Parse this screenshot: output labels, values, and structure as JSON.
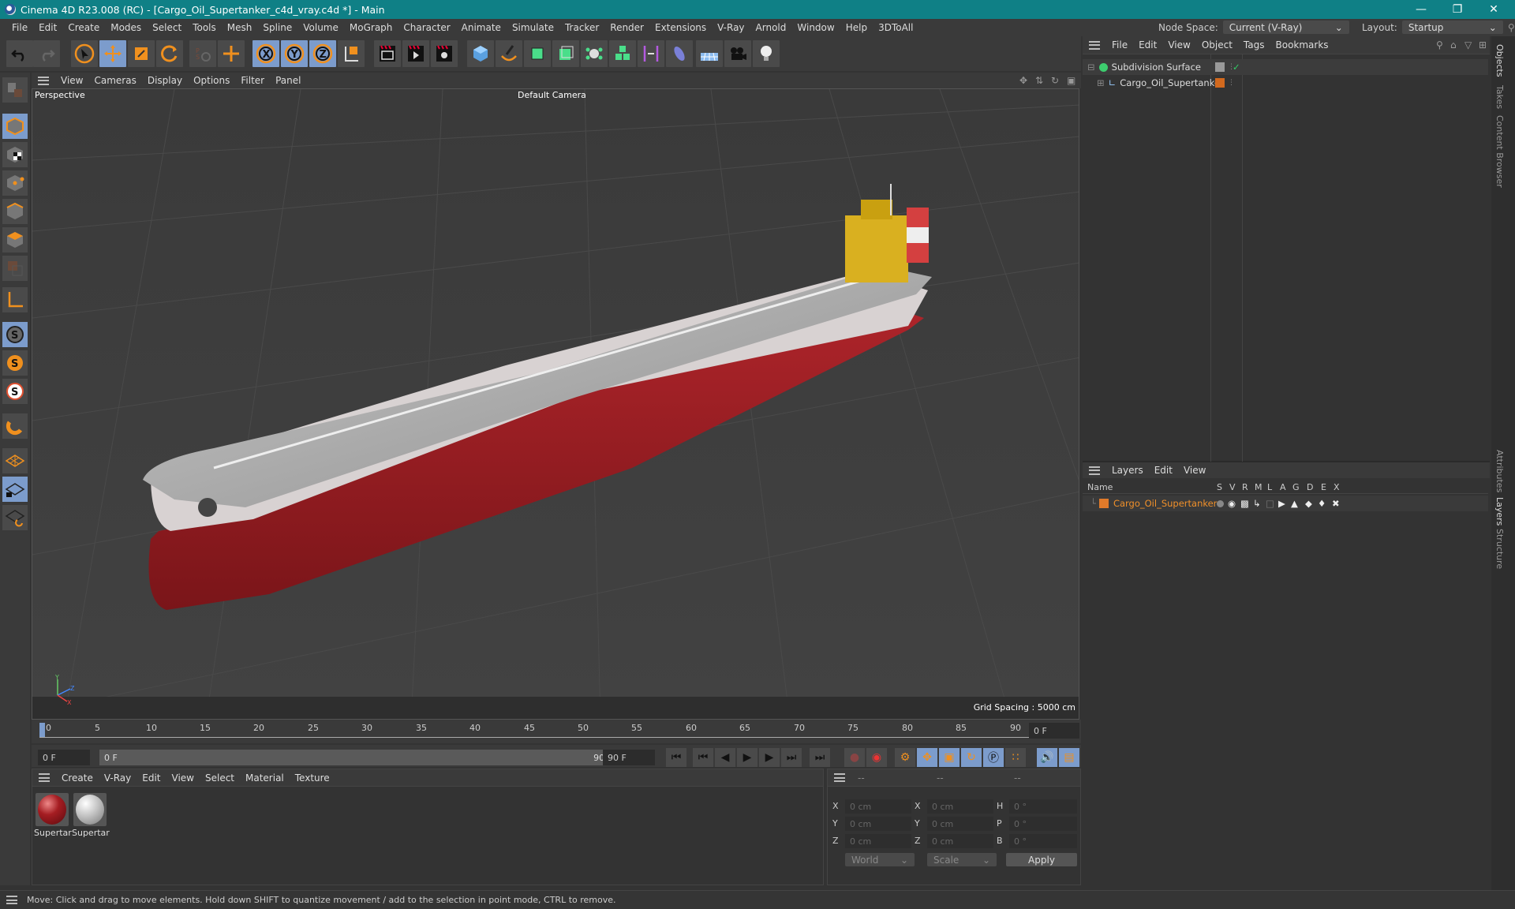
{
  "window": {
    "title": "Cinema 4D R23.008 (RC) - [Cargo_Oil_Supertanker_c4d_vray.c4d *] - Main",
    "controls": [
      "minimize",
      "restore",
      "close"
    ]
  },
  "menubar": {
    "items": [
      "File",
      "Edit",
      "Create",
      "Modes",
      "Select",
      "Tools",
      "Mesh",
      "Spline",
      "Volume",
      "MoGraph",
      "Character",
      "Animate",
      "Simulate",
      "Tracker",
      "Render",
      "Extensions",
      "V-Ray",
      "Arnold",
      "Window",
      "Help",
      "3DToAll"
    ],
    "node_space_label": "Node Space:",
    "node_space_value": "Current (V-Ray)",
    "layout_label": "Layout:",
    "layout_value": "Startup"
  },
  "toolbar": {
    "buttons": [
      {
        "icon": "undo-icon"
      },
      {
        "icon": "redo-icon"
      },
      {
        "icon": "select-arrow-icon"
      },
      {
        "icon": "move-icon",
        "active": true
      },
      {
        "icon": "scale-icon"
      },
      {
        "icon": "rotate-icon"
      },
      {
        "icon": "psr-icon"
      },
      {
        "icon": "move-alt-icon"
      },
      {
        "icon": "x-axis-icon",
        "label": "X",
        "active": true
      },
      {
        "icon": "y-axis-icon",
        "label": "Y",
        "active": true
      },
      {
        "icon": "z-axis-icon",
        "label": "Z",
        "active": true
      },
      {
        "icon": "coordinate-system-icon"
      },
      {
        "icon": "render-view-icon"
      },
      {
        "icon": "render-picture-viewer-icon"
      },
      {
        "icon": "render-settings-icon"
      },
      {
        "icon": "cube-icon"
      },
      {
        "icon": "pen-spline-icon"
      },
      {
        "icon": "subdivision-icon"
      },
      {
        "icon": "extrude-icon"
      },
      {
        "icon": "mograph-cloner-icon"
      },
      {
        "icon": "array-icon"
      },
      {
        "icon": "deformer-icon"
      },
      {
        "icon": "field-icon"
      },
      {
        "icon": "floor-icon"
      },
      {
        "icon": "camera-icon"
      },
      {
        "icon": "light-icon"
      }
    ]
  },
  "left_tools": [
    "make-editable-icon",
    "model-mode-icon",
    "texture-mode-icon",
    "point-mode-icon",
    "edge-mode-icon",
    "polygon-mode-icon",
    "uv-mode-icon",
    "axis-icon",
    "solo-off-icon",
    "solo-icon",
    "solo-hierarchy-icon",
    "snap-magnet-icon",
    "workplane-icon",
    "workplane-lock-icon",
    "workplane-align-icon"
  ],
  "viewport": {
    "menu": [
      "View",
      "Cameras",
      "Display",
      "Options",
      "Filter",
      "Panel"
    ],
    "view_name": "Perspective",
    "camera": "Default Camera",
    "grid_spacing": "Grid Spacing : 5000 cm",
    "nav_icons": [
      "pan-icon",
      "dolly-icon",
      "orbit-icon",
      "maximize-view-icon"
    ]
  },
  "timeline": {
    "ticks": [
      "0",
      "5",
      "10",
      "15",
      "20",
      "25",
      "30",
      "35",
      "40",
      "45",
      "50",
      "55",
      "60",
      "65",
      "70",
      "75",
      "80",
      "85",
      "90"
    ],
    "current_frame": "0 F",
    "start_field": "0 F",
    "range_start": "0 F",
    "range_end": "90 F",
    "end_field": "90 F",
    "right_frame": "0 F"
  },
  "material_panel": {
    "menu": [
      "Create",
      "V-Ray",
      "Edit",
      "View",
      "Select",
      "Material",
      "Texture"
    ],
    "materials": [
      {
        "name": "Supertar",
        "color": "#a51d22"
      },
      {
        "name": "Supertar",
        "color": "#c9c9c9"
      }
    ]
  },
  "coordinates": {
    "headers": [
      "--",
      "--",
      "--"
    ],
    "rows": [
      {
        "l1": "X",
        "v1": "0 cm",
        "l2": "X",
        "v2": "0 cm",
        "l3": "H",
        "v3": "0 °"
      },
      {
        "l1": "Y",
        "v1": "0 cm",
        "l2": "Y",
        "v2": "0 cm",
        "l3": "P",
        "v3": "0 °"
      },
      {
        "l1": "Z",
        "v1": "0 cm",
        "l2": "Z",
        "v2": "0 cm",
        "l3": "B",
        "v3": "0 °"
      }
    ],
    "mode": "World",
    "transform": "Scale",
    "apply": "Apply"
  },
  "objects_panel": {
    "menu": [
      "File",
      "Edit",
      "View",
      "Object",
      "Tags",
      "Bookmarks"
    ],
    "items": [
      {
        "name": "Subdivision Surface",
        "icon": "subdivision-surface-icon"
      },
      {
        "name": "Cargo_Oil_Supertanker",
        "icon": "null-object-icon",
        "layer_color": "#d2691e"
      }
    ]
  },
  "layers_panel": {
    "menu": [
      "Layers",
      "Edit",
      "View"
    ],
    "columns": [
      "Name",
      "S",
      "V",
      "R",
      "M",
      "L",
      "A",
      "G",
      "D",
      "E",
      "X"
    ],
    "rows": [
      {
        "name": "Cargo_Oil_Supertanker",
        "color": "#e07a2a"
      }
    ]
  },
  "side_tabs": {
    "top": [
      "Objects",
      "Takes",
      "Content Browser"
    ],
    "bottom": [
      "Attributes",
      "Layers",
      "Structure"
    ]
  },
  "status": {
    "text": "Move: Click and drag to move elements. Hold down SHIFT to quantize movement / add to the selection in point mode, CTRL to remove."
  },
  "colors": {
    "titlebar": "#0f8086",
    "accent_selected": "#7c9ccc",
    "orange": "#f0901e"
  }
}
